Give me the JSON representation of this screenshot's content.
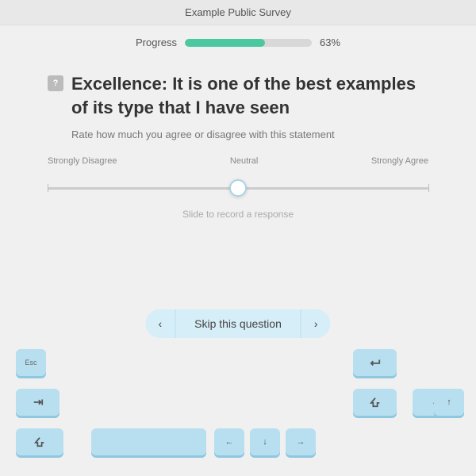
{
  "topBar": {
    "title": "Example Public Survey"
  },
  "progress": {
    "label": "Progress",
    "percent": 63,
    "displayPct": "63%",
    "fillWidth": "63%"
  },
  "question": {
    "badge": "?",
    "text": "Excellence: It is one of the best examples of its type that I have seen",
    "subtitle": "Rate how much you agree or disagree with this statement",
    "scaleLeft": "Strongly Disagree",
    "scaleMiddle": "Neutral",
    "scaleRight": "Strongly Agree",
    "sliderHint": "Slide to record a response"
  },
  "navigation": {
    "prevArrow": "‹",
    "nextArrow": "›",
    "skipLabel": "Skip this question"
  },
  "keyboard": {
    "escLabel": "Esc",
    "tabLabel": "Tab",
    "shiftLabel": "⇧",
    "enterLabel": "↵",
    "spaceLabel": "",
    "arrowUp": "↑",
    "arrowDown": "↓",
    "arrowLeft": "←",
    "arrowRight": "→"
  }
}
